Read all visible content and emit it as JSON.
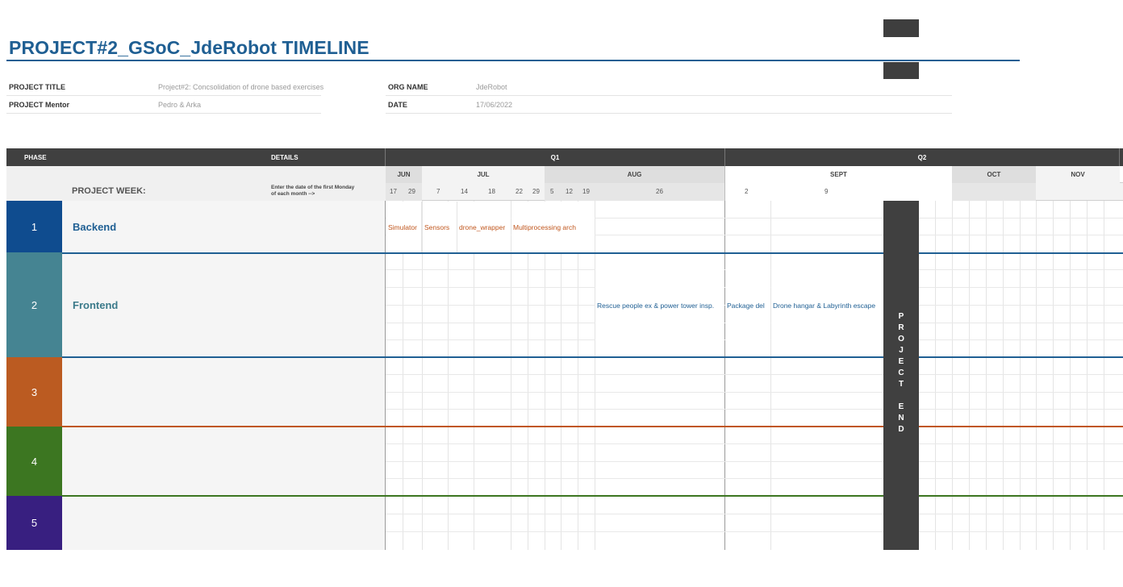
{
  "title": "PROJECT#2_GSoC_JdeRobot TIMELINE",
  "info": {
    "project_title_label": "PROJECT TITLE",
    "project_title_value": "Project#2: Concsolidation of drone based exercises",
    "mentor_label": "PROJECT Mentor",
    "mentor_value": "Pedro & Arka",
    "org_label": "ORG NAME",
    "org_value": "JdeRobot",
    "date_label": "DATE",
    "date_value": "17/06/2022"
  },
  "header": {
    "phase": "PHASE",
    "details": "DETAILS",
    "q1": "Q1",
    "q2": "Q2",
    "project_week": "PROJECT WEEK:",
    "hint": "Enter the date of the first Monday of each month -->"
  },
  "months": [
    "JUN",
    "JUL",
    "AUG",
    "SEPT",
    "OCT",
    "NOV"
  ],
  "days": [
    "17",
    "29",
    "7",
    "14",
    "18",
    "22",
    "29",
    "5",
    "12",
    "19",
    "26",
    "2",
    "9"
  ],
  "phases": [
    {
      "number": "1",
      "name": "Backend",
      "color": "#0f4c8f",
      "name_color": "#1f5f93",
      "line_color": "#1f5f93"
    },
    {
      "number": "2",
      "name": "Frontend",
      "color": "#458492",
      "name_color": "#3b7a8a",
      "line_color": "#1f5f93"
    },
    {
      "number": "3",
      "name": "",
      "color": "#bb5b21",
      "name_color": "#bb5b21",
      "line_color": "#c0561d"
    },
    {
      "number": "4",
      "name": "",
      "color": "#3c7621",
      "name_color": "#3c7621",
      "line_color": "#3c7621"
    },
    {
      "number": "5",
      "name": "",
      "color": "#381f80",
      "name_color": "#381f80",
      "line_color": "#381f80"
    }
  ],
  "tasks": {
    "backend": [
      "Simulator",
      "Sensors",
      "drone_wrapper",
      "Multiprocessing arch"
    ],
    "frontend": [
      "Rescue people ex & power tower insp.",
      "Package del",
      "Drone hangar & Labyrinth escape"
    ]
  },
  "project_end": "PROJECT END",
  "colors": {
    "accent": "#1f5f93",
    "dark_header": "#404040",
    "task_orange": "#c0561d"
  }
}
